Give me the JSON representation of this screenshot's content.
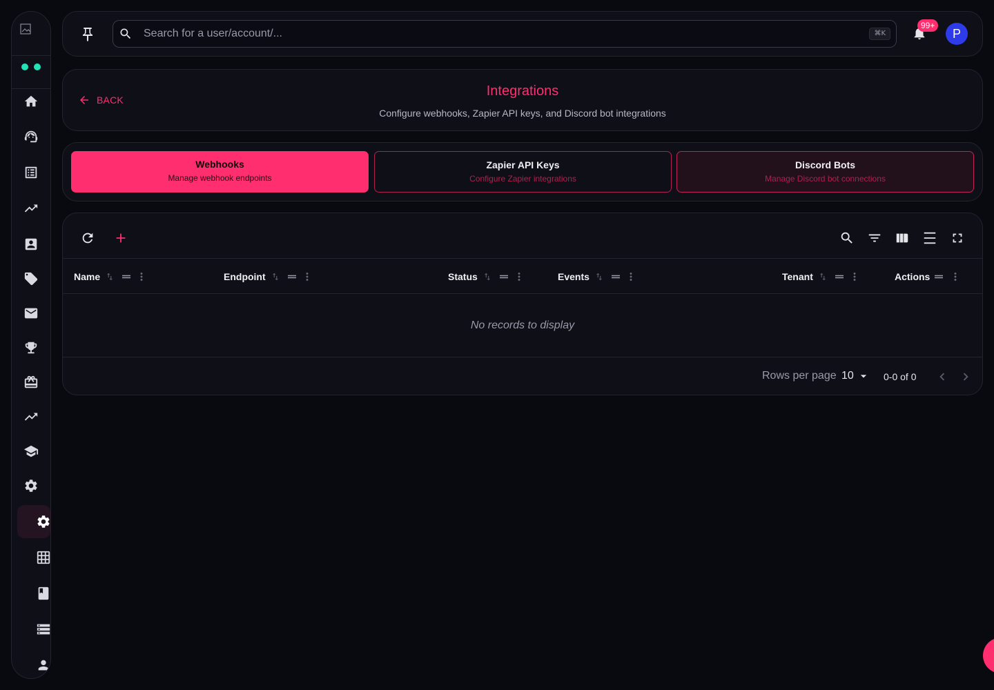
{
  "topbar": {
    "search_placeholder": "Search for a user/account/...",
    "shortcut": "⌘K",
    "notification_count": "99+",
    "avatar_initial": "P"
  },
  "sidebar": {
    "icons": [
      "home-icon",
      "support-agent-icon",
      "list-icon",
      "trending-up-icon",
      "contact-card-icon",
      "tag-icon",
      "mail-icon",
      "trophy-icon",
      "gift-card-icon",
      "trending-up-icon",
      "school-icon",
      "gear-icon",
      "gear-icon",
      "grid-icon",
      "book-icon",
      "storage-icon",
      "person-icon"
    ],
    "status_dot_color": "#22e3b4"
  },
  "header": {
    "back_label": "BACK",
    "title": "Integrations",
    "subtitle": "Configure webhooks, Zapier API keys, and Discord bot integrations"
  },
  "tabs": [
    {
      "title": "Webhooks",
      "subtitle": "Manage webhook endpoints"
    },
    {
      "title": "Zapier API Keys",
      "subtitle": "Configure Zapier integrations"
    },
    {
      "title": "Discord Bots",
      "subtitle": "Manage Discord bot connections"
    }
  ],
  "table": {
    "columns": [
      "Name",
      "Endpoint",
      "Status",
      "Events",
      "Tenant",
      "Actions"
    ],
    "empty_text": "No records to display",
    "rows_per_page_label": "Rows per page",
    "rows_per_page_value": "10",
    "page_info": "0-0 of 0"
  },
  "colors": {
    "accent": "#ff2e6e",
    "background": "#090910",
    "card": "#0f0f18",
    "avatar": "#2d3be8"
  }
}
